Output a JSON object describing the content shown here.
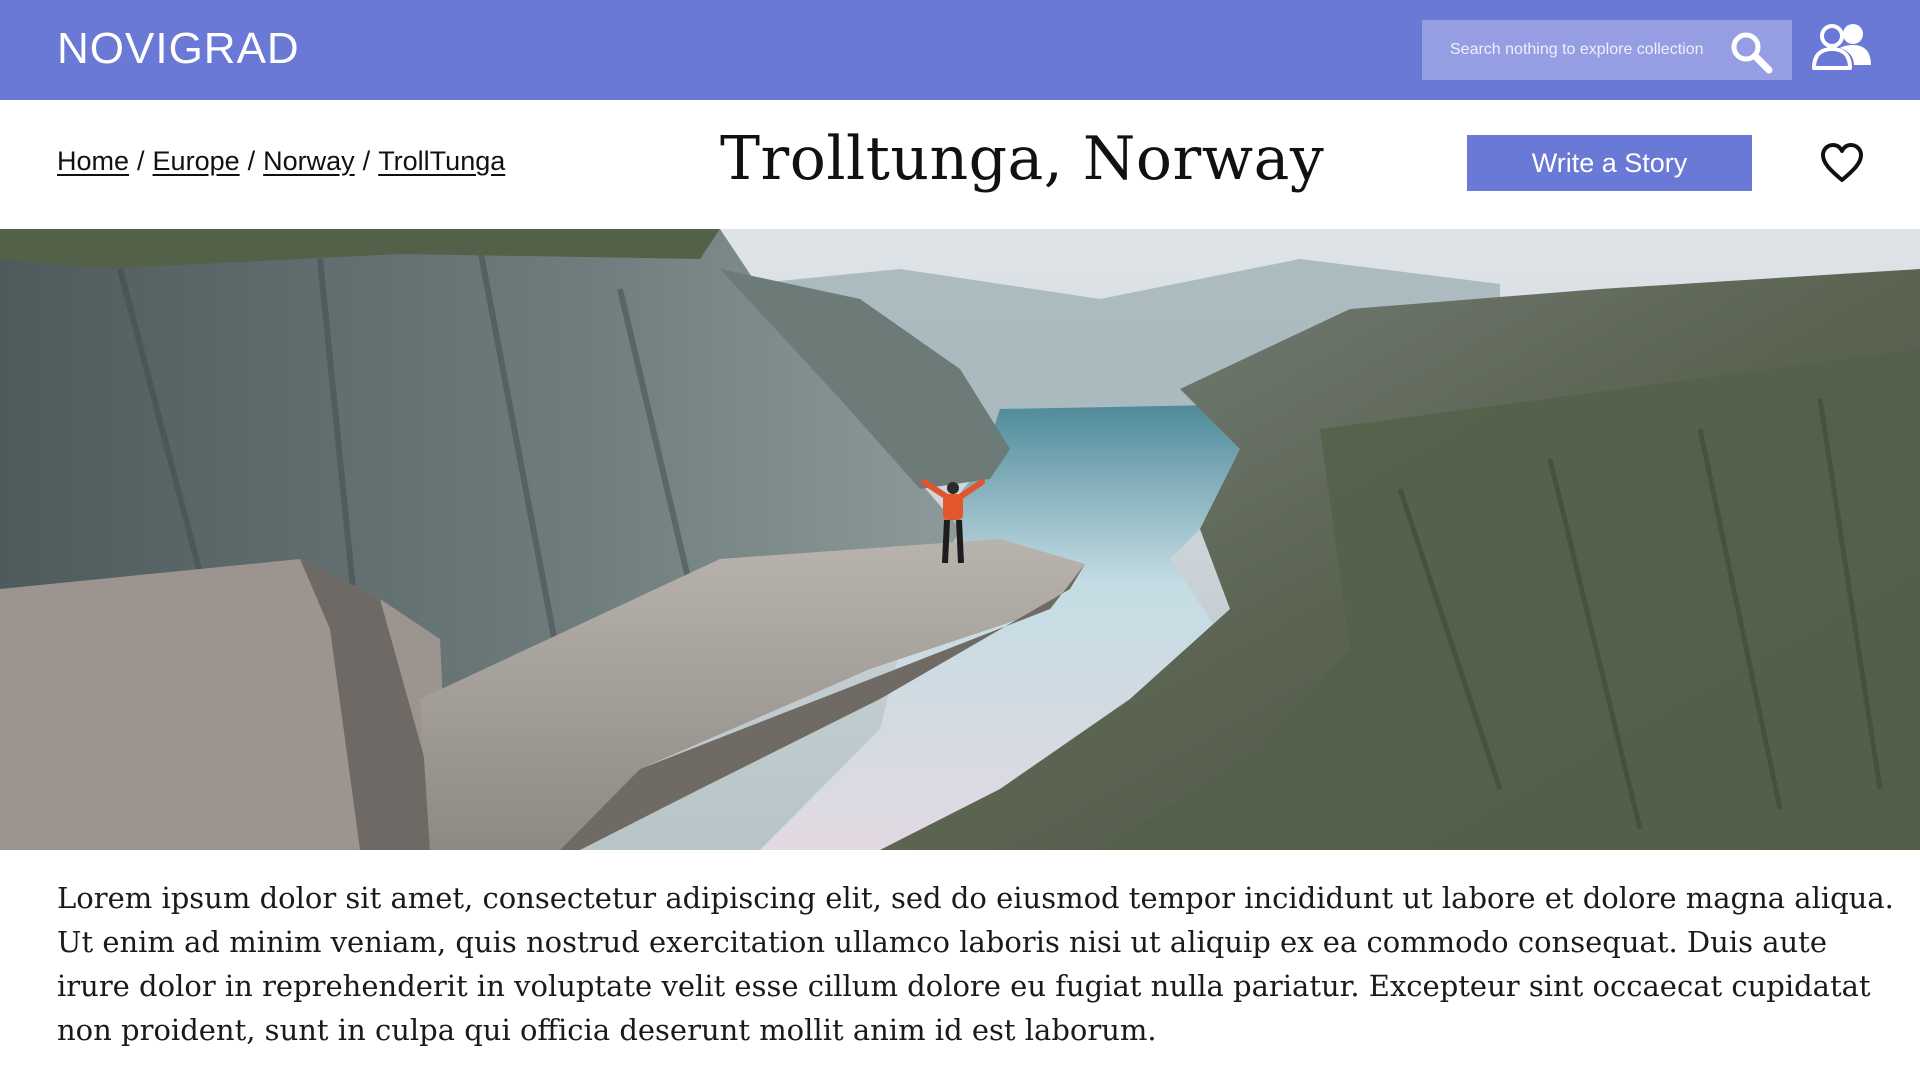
{
  "header": {
    "brand": "NOVIGRAD",
    "search_placeholder": "Search nothing to explore collection",
    "icons": [
      "search-icon",
      "user-group-icon"
    ],
    "colors": {
      "bar": "#6a78d6",
      "search_bg": "#959ee3"
    }
  },
  "breadcrumb": {
    "items": [
      "Home",
      "Europe",
      "Norway",
      "TrollTunga"
    ],
    "separator": "/"
  },
  "page": {
    "title": "Trolltunga, Norway",
    "write_button": "Write a Story",
    "favorite_icon": "heart-outline-icon"
  },
  "hero": {
    "alt": "Hiker with arms raised standing on the Trolltunga rock ledge above a fjord between steep cliffs"
  },
  "body": {
    "line1": "Lorem ipsum dolor sit amet, consectetur adipiscing elit, sed do eiusmod tempor incididunt ut labore et dolore magna aliqua.",
    "line2": "Ut enim ad minim veniam, quis nostrud exercitation ullamco laboris nisi ut aliquip ex ea commodo consequat. Duis aute irure dolor in reprehenderit in voluptate velit esse cillum dolore eu fugiat nulla pariatur. Excepteur sint occaecat cupidatat non proident, sunt in culpa qui officia deserunt mollit anim id est laborum."
  }
}
